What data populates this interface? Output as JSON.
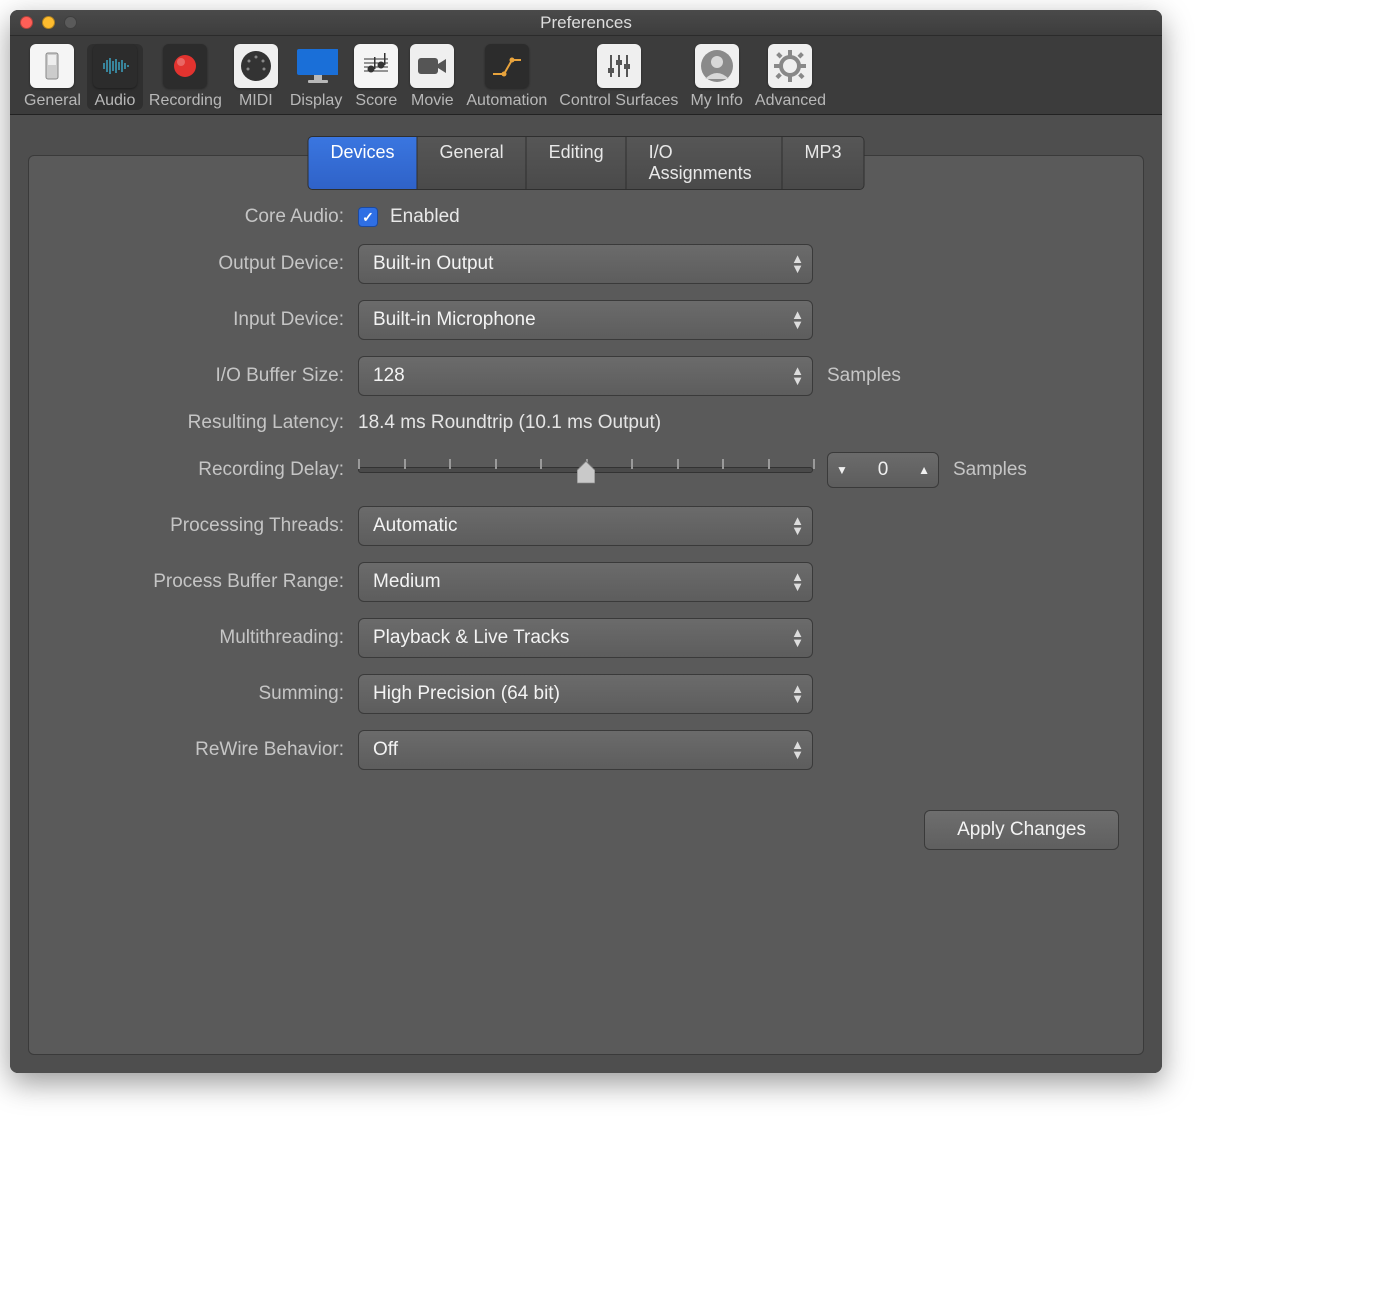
{
  "window": {
    "title": "Preferences"
  },
  "toolbar": {
    "items": [
      {
        "label": "General"
      },
      {
        "label": "Audio"
      },
      {
        "label": "Recording"
      },
      {
        "label": "MIDI"
      },
      {
        "label": "Display"
      },
      {
        "label": "Score"
      },
      {
        "label": "Movie"
      },
      {
        "label": "Automation"
      },
      {
        "label": "Control Surfaces"
      },
      {
        "label": "My Info"
      },
      {
        "label": "Advanced"
      }
    ],
    "active": "Audio"
  },
  "tabs": {
    "items": [
      "Devices",
      "General",
      "Editing",
      "I/O Assignments",
      "MP3"
    ],
    "active": "Devices"
  },
  "labels": {
    "core_audio": "Core Audio:",
    "enabled": "Enabled",
    "output_device": "Output Device:",
    "input_device": "Input Device:",
    "io_buffer": "I/O Buffer Size:",
    "resulting_latency": "Resulting Latency:",
    "recording_delay": "Recording Delay:",
    "processing_threads": "Processing Threads:",
    "process_buffer_range": "Process Buffer Range:",
    "multithreading": "Multithreading:",
    "summing": "Summing:",
    "rewire": "ReWire Behavior:",
    "samples": "Samples",
    "apply": "Apply Changes"
  },
  "values": {
    "core_audio_enabled": true,
    "output_device": "Built-in Output",
    "input_device": "Built-in Microphone",
    "io_buffer": "128",
    "resulting_latency": "18.4 ms Roundtrip (10.1 ms Output)",
    "recording_delay": "0",
    "processing_threads": "Automatic",
    "process_buffer_range": "Medium",
    "multithreading": "Playback & Live Tracks",
    "summing": "High Precision (64 bit)",
    "rewire": "Off"
  }
}
